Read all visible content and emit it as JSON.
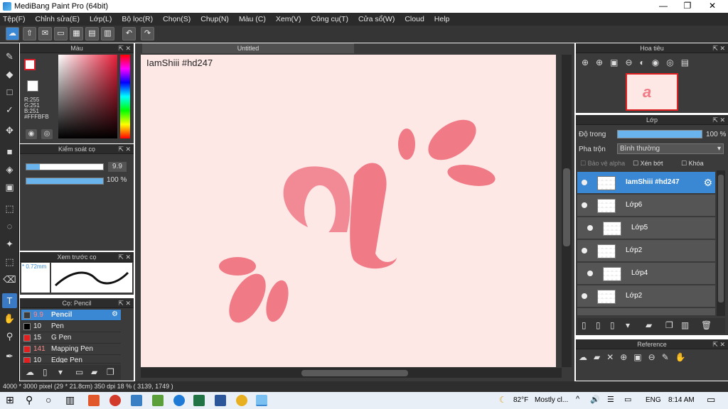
{
  "window": {
    "title": "MediBang Paint Pro (64bit)",
    "min": "—",
    "max": "❐",
    "close": "✕"
  },
  "menu": [
    "Tệp(F)",
    "Chỉnh sửa(E)",
    "Lớp(L)",
    "Bộ lọc(R)",
    "Chọn(S)",
    "Chụp(N)",
    "Màu (C)",
    "Xem(V)",
    "Công cụ(T)",
    "Cửa sổ(W)",
    "Cloud",
    "Help"
  ],
  "color_panel": {
    "title": "Màu",
    "readout": [
      "R:255",
      "G:251",
      "B:251",
      "#FFFBFB"
    ],
    "primary": "#ffffff",
    "accent": "#d81f2a"
  },
  "brush_control": {
    "title": "Kiểm soát cọ",
    "size": "9.9",
    "opacity": "100 %"
  },
  "preview": {
    "title": "Xem trước cọ",
    "size": "* 0.72mm"
  },
  "brush_list": {
    "title": "Cọ: Pencil",
    "items": [
      {
        "size": "9.9",
        "name": "Pencil",
        "color": "#3b3b3b",
        "selected": true
      },
      {
        "size": "10",
        "name": "Pen",
        "color": "#000000"
      },
      {
        "size": "15",
        "name": "G Pen",
        "color": "#e02020"
      },
      {
        "size": "141",
        "name": "Mapping Pen",
        "color": "#e02020"
      },
      {
        "size": "10",
        "name": "Edge Pen",
        "color": "#e02020"
      }
    ]
  },
  "canvas": {
    "tab": "Untitled",
    "signature": "IamShiii #hd247",
    "background": "#fde8e6",
    "art_color": "#f07a86"
  },
  "navigator": {
    "title": "Hoa tiêu"
  },
  "layer_panel": {
    "title": "Lớp",
    "opacity_label": "Độ trong",
    "opacity_value": "100 %",
    "blend_label": "Pha trộn",
    "blend_value": "Bình thường",
    "protect_alpha": "Bảo vệ alpha",
    "clip": "Xén bớt",
    "lock": "Khóa",
    "layers": [
      "IamShiii #hd247",
      "Lớp6",
      "Lớp5",
      "Lớp2",
      "Lớp4",
      "Lớp2"
    ]
  },
  "reference": {
    "title": "Reference"
  },
  "status": "4000 * 3000 pixel   (29 * 21.8cm)   350 dpi   18 %   ( 3139, 1749 )",
  "taskbar": {
    "weather_temp": "82°F",
    "weather_text": "Mostly cl...",
    "lang": "ENG",
    "time": "8:14 AM"
  }
}
